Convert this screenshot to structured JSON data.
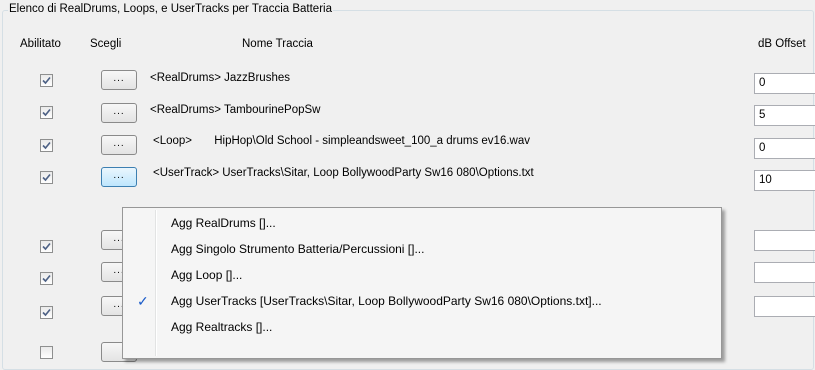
{
  "group_title": "Elenco di RealDrums, Loops, e UserTracks per Traccia Batteria",
  "headers": {
    "enabled": "Abilitato",
    "choose": "Scegli",
    "track_name": "Nome Traccia",
    "db_offset": "dB Offset"
  },
  "rows": [
    {
      "enabled": true,
      "button": "...",
      "type": "<RealDrums>",
      "name": "JazzBrushes",
      "db": "0"
    },
    {
      "enabled": true,
      "button": "...",
      "type": "<RealDrums>",
      "name": "TambourinePopSw",
      "db": "5"
    },
    {
      "enabled": true,
      "button": "...",
      "type": "<Loop>",
      "name": "HipHop\\Old School - simpleandsweet_100_a drums ev16.wav",
      "db": "0"
    },
    {
      "enabled": true,
      "button": "...",
      "type": "<UserTrack>",
      "name": "UserTracks\\Sitar, Loop BollywoodParty Sw16 080\\Options.txt",
      "db": "10"
    },
    {
      "enabled": true,
      "button": "..."
    },
    {
      "enabled": true,
      "button": "..."
    },
    {
      "enabled": true,
      "button": "..."
    },
    {
      "enabled": false,
      "button": ""
    }
  ],
  "context_menu": {
    "items": [
      {
        "label": "Agg RealDrums []...",
        "checked": false
      },
      {
        "label": "Agg Singolo Strumento Batteria/Percussioni []...",
        "checked": false
      },
      {
        "label": "Agg Loop []...",
        "checked": false
      },
      {
        "label": "Agg UserTracks [UserTracks\\Sitar, Loop BollywoodParty Sw16 080\\Options.txt]...",
        "checked": true
      },
      {
        "label": "Agg Realtracks []...",
        "checked": false
      }
    ],
    "check_glyph": "✓"
  },
  "colors": {
    "window_bg": "#f0f0f0",
    "hot_button_border": "#3c7fb1",
    "check_color": "#1a5bc9"
  }
}
